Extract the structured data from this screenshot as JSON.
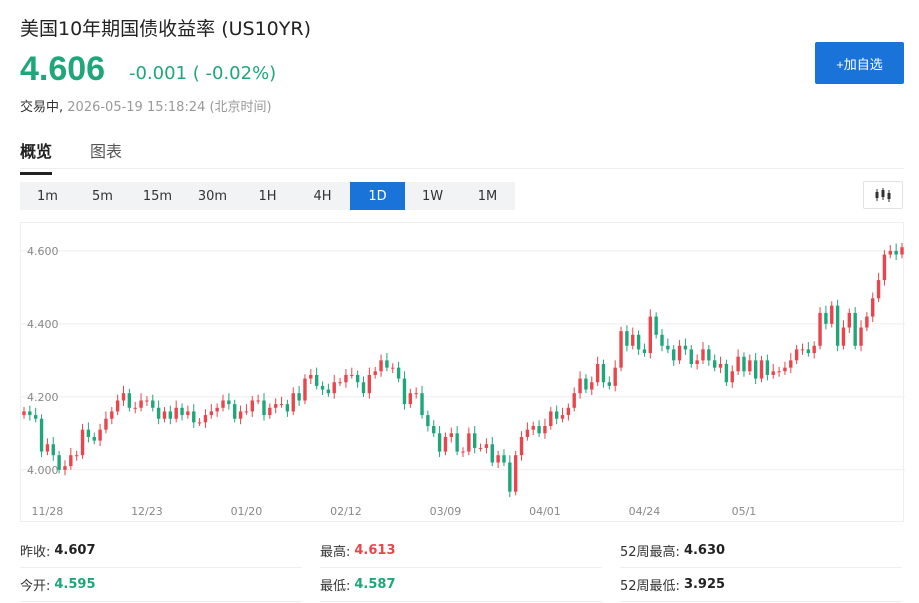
{
  "header": {
    "title": "美国10年期国债收益率 (US10YR)",
    "price": "4.606",
    "change": "-0.001 ( -0.02%)",
    "status_label": "交易中,",
    "timestamp": "2026-05-19 15:18:24 (北京时间)",
    "add_button": "+加自选"
  },
  "tabs": [
    {
      "label": "概览",
      "active": true
    },
    {
      "label": "图表",
      "active": false
    }
  ],
  "ranges": [
    "1m",
    "5m",
    "15m",
    "30m",
    "1H",
    "4H",
    "1D",
    "1W",
    "1M"
  ],
  "active_range": "1D",
  "colors": {
    "up": "#e8464c",
    "down": "#1fa67a",
    "accent": "#1a73d9"
  },
  "stats": [
    {
      "label": "昨收:",
      "value": "4.607",
      "tone": "neutral"
    },
    {
      "label": "最高:",
      "value": "4.613",
      "tone": "up"
    },
    {
      "label": "52周最高:",
      "value": "4.630",
      "tone": "neutral"
    },
    {
      "label": "今开:",
      "value": "4.595",
      "tone": "down"
    },
    {
      "label": "最低:",
      "value": "4.587",
      "tone": "down"
    },
    {
      "label": "52周最低:",
      "value": "3.925",
      "tone": "neutral"
    }
  ],
  "chart_data": {
    "type": "candlestick",
    "y_ticks": [
      "4.600",
      "4.400",
      "4.200",
      "4.000"
    ],
    "y_tick_values": [
      4.6,
      4.4,
      4.2,
      4.0
    ],
    "ylim": [
      3.92,
      4.66
    ],
    "x_ticks": [
      "11/28",
      "12/23",
      "01/20",
      "02/12",
      "03/09",
      "04/01",
      "04/24",
      "05/1"
    ],
    "x_tick_index": [
      4,
      21,
      38,
      55,
      72,
      89,
      106,
      123
    ],
    "grid": true,
    "close": [
      4.16,
      4.15,
      4.14,
      4.05,
      4.07,
      4.04,
      4.0,
      4.01,
      4.04,
      4.04,
      4.11,
      4.09,
      4.08,
      4.11,
      4.14,
      4.16,
      4.19,
      4.21,
      4.17,
      4.17,
      4.19,
      4.19,
      4.17,
      4.14,
      4.16,
      4.14,
      4.17,
      4.15,
      4.16,
      4.13,
      4.13,
      4.15,
      4.16,
      4.17,
      4.19,
      4.18,
      4.14,
      4.16,
      4.16,
      4.19,
      4.19,
      4.15,
      4.17,
      4.18,
      4.18,
      4.16,
      4.21,
      4.19,
      4.25,
      4.26,
      4.23,
      4.22,
      4.21,
      4.24,
      4.24,
      4.26,
      4.26,
      4.24,
      4.21,
      4.26,
      4.27,
      4.3,
      4.28,
      4.28,
      4.25,
      4.18,
      4.21,
      4.21,
      4.15,
      4.12,
      4.1,
      4.05,
      4.09,
      4.1,
      4.05,
      4.05,
      4.1,
      4.06,
      4.06,
      4.07,
      4.02,
      4.04,
      4.02,
      3.94,
      4.04,
      4.09,
      4.11,
      4.12,
      4.1,
      4.12,
      4.16,
      4.14,
      4.15,
      4.17,
      4.21,
      4.25,
      4.22,
      4.24,
      4.29,
      4.24,
      4.23,
      4.28,
      4.38,
      4.34,
      4.37,
      4.33,
      4.32,
      4.42,
      4.37,
      4.34,
      4.33,
      4.3,
      4.34,
      4.33,
      4.29,
      4.3,
      4.33,
      4.3,
      4.28,
      4.29,
      4.24,
      4.27,
      4.31,
      4.27,
      4.3,
      4.25,
      4.3,
      4.26,
      4.27,
      4.27,
      4.28,
      4.3,
      4.33,
      4.33,
      4.32,
      4.34,
      4.43,
      4.4,
      4.45,
      4.34,
      4.39,
      4.43,
      4.34,
      4.39,
      4.42,
      4.47,
      4.52,
      4.59,
      4.6,
      4.59,
      4.61
    ]
  }
}
